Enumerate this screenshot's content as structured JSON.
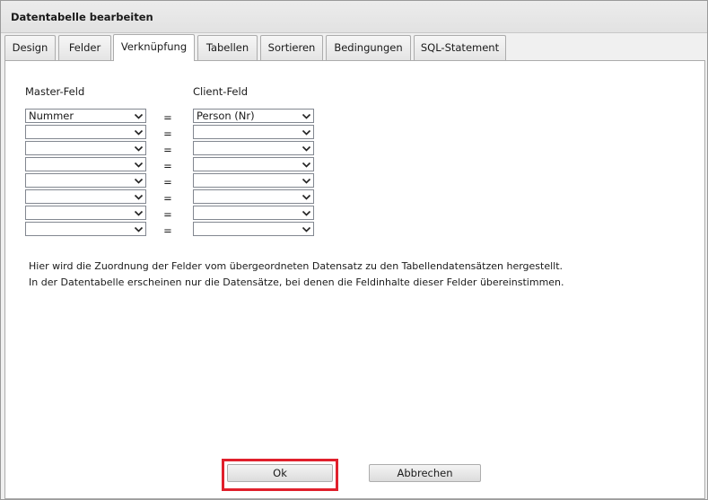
{
  "window": {
    "title": "Datentabelle bearbeiten"
  },
  "tabs": [
    {
      "label": "Design"
    },
    {
      "label": "Felder"
    },
    {
      "label": "Verknüpfung"
    },
    {
      "label": "Tabellen"
    },
    {
      "label": "Sortieren"
    },
    {
      "label": "Bedingungen"
    },
    {
      "label": "SQL-Statement"
    }
  ],
  "active_tab": "Verknüpfung",
  "link": {
    "master_header": "Master-Feld",
    "client_header": "Client-Feld",
    "equals_sign": "=",
    "rows": [
      {
        "master": "Nummer",
        "client": "Person (Nr)"
      },
      {
        "master": "",
        "client": ""
      },
      {
        "master": "",
        "client": ""
      },
      {
        "master": "",
        "client": ""
      },
      {
        "master": "",
        "client": ""
      },
      {
        "master": "",
        "client": ""
      },
      {
        "master": "",
        "client": ""
      },
      {
        "master": "",
        "client": ""
      }
    ]
  },
  "info": {
    "line1": "Hier wird die Zuordnung der Felder vom übergeordneten Datensatz zu den Tabellendatensätzen hergestellt.",
    "line2": "In der Datentabelle erscheinen nur die Datensätze, bei denen die Feldinhalte dieser Felder übereinstimmen."
  },
  "buttons": {
    "ok": "Ok",
    "cancel": "Abbrechen"
  },
  "colors": {
    "highlight": "#e0202c",
    "border": "#acacac"
  }
}
